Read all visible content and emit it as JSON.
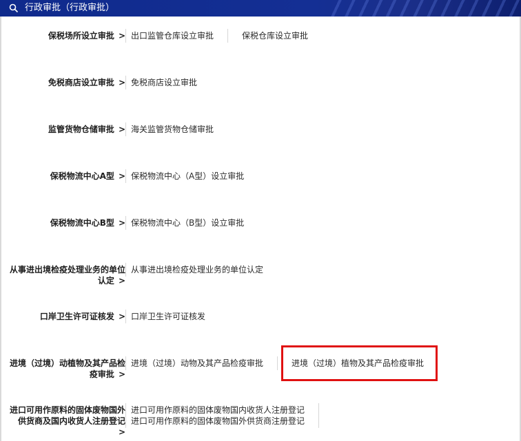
{
  "header": {
    "title": "行政审批（行政审批）"
  },
  "rows": [
    {
      "category": "保税场所设立审批",
      "arrow": ">",
      "items": [
        "出口监管仓库设立审批",
        "保税仓库设立审批"
      ]
    },
    {
      "category": "免税商店设立审批",
      "arrow": ">",
      "items": [
        "免税商店设立审批"
      ]
    },
    {
      "category": "监管货物仓储审批",
      "arrow": ">",
      "items": [
        "海关监管货物仓储审批"
      ]
    },
    {
      "category": "保税物流中心A型",
      "arrow": ">",
      "items": [
        "保税物流中心（A型）设立审批"
      ]
    },
    {
      "category": "保税物流中心B型",
      "arrow": ">",
      "items": [
        "保税物流中心（B型）设立审批"
      ]
    },
    {
      "category_lines": [
        "从事进出境检疫处理业务的单位",
        "认定"
      ],
      "arrow": ">",
      "items": [
        "从事进出境检疫处理业务的单位认定"
      ]
    },
    {
      "category": "口岸卫生许可证核发",
      "arrow": ">",
      "items": [
        "口岸卫生许可证核发"
      ]
    },
    {
      "category_lines": [
        "进境（过境）动植物及其产品检",
        "疫审批"
      ],
      "arrow": ">",
      "items": [
        "进境（过境）动物及其产品检疫审批",
        "进境（过境）植物及其产品检疫审批"
      ]
    },
    {
      "category_lines": [
        "进口可用作原料的固体废物国外",
        "供货商及国内收货人注册登记"
      ],
      "arrow": ">",
      "items": [
        "进口可用作原料的固体废物国内收货人注册登记",
        "进口可用作原料的固体废物国外供货商注册登记"
      ]
    }
  ],
  "highlight_color": "#e01010"
}
